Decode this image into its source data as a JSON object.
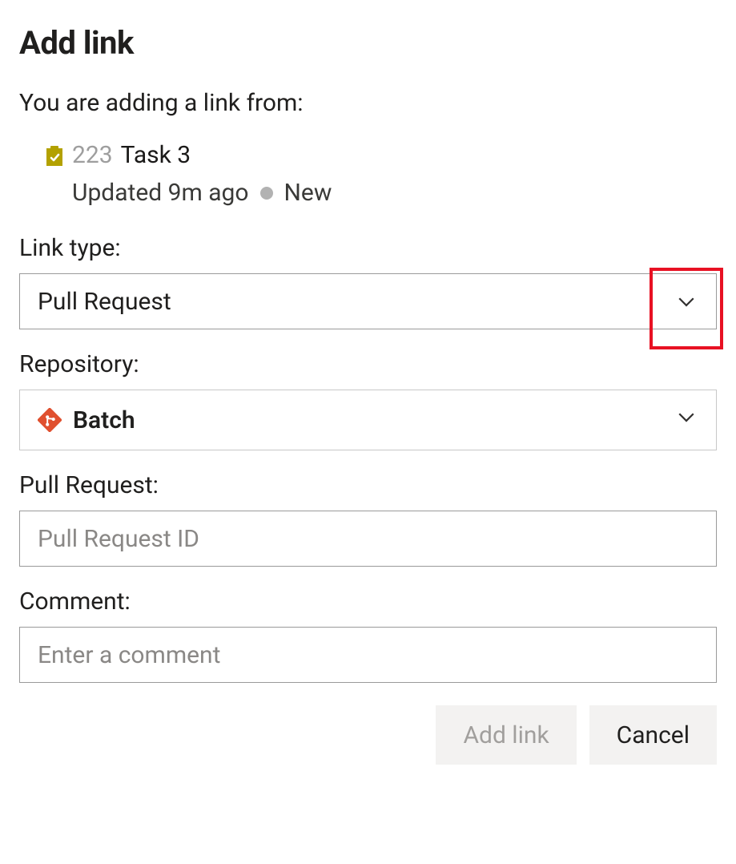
{
  "title": "Add link",
  "lead": "You are adding a link from:",
  "work_item": {
    "id": "223",
    "name": "Task 3",
    "updated": "Updated 9m ago",
    "state": "New"
  },
  "link_type": {
    "label": "Link type:",
    "value": "Pull Request"
  },
  "repository": {
    "label": "Repository:",
    "value": "Batch"
  },
  "pull_request": {
    "label": "Pull Request:",
    "placeholder": "Pull Request ID"
  },
  "comment": {
    "label": "Comment:",
    "placeholder": "Enter a comment"
  },
  "buttons": {
    "add": "Add link",
    "cancel": "Cancel"
  },
  "colors": {
    "task_icon": "#b3a100",
    "repo_icon": "#e0502f",
    "highlight": "#e81123"
  }
}
